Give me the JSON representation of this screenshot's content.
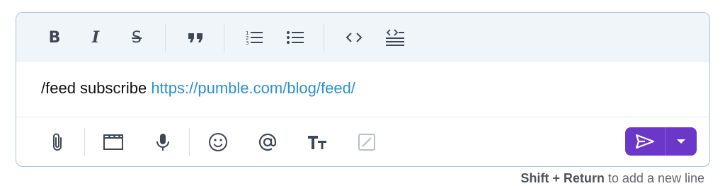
{
  "composer": {
    "text_prefix": "/feed subscribe ",
    "link_text": "https://pumble.com/blog/feed/"
  },
  "toolbar": {
    "items": [
      {
        "icon": "bold-icon"
      },
      {
        "icon": "italic-icon"
      },
      {
        "icon": "strikethrough-icon"
      },
      {
        "icon": "quote-icon"
      },
      {
        "icon": "numbered-list-icon"
      },
      {
        "icon": "bulleted-list-icon"
      },
      {
        "icon": "code-icon"
      },
      {
        "icon": "code-block-icon"
      }
    ]
  },
  "bottombar": {
    "items": [
      {
        "icon": "paperclip-icon"
      },
      {
        "icon": "video-icon"
      },
      {
        "icon": "microphone-icon"
      },
      {
        "icon": "emoji-icon"
      },
      {
        "icon": "mention-icon"
      },
      {
        "icon": "text-format-icon"
      },
      {
        "icon": "slash-command-icon"
      }
    ]
  },
  "send": {
    "icon": "send-icon",
    "menu_icon": "caret-down-icon"
  },
  "hint": {
    "keys": "Shift + Return",
    "text": " to add a new line"
  },
  "colors": {
    "accent": "#6a37c9",
    "link": "#2b91cf",
    "toolbar_bg": "#f0f5f9",
    "border": "#a9c3d6"
  }
}
